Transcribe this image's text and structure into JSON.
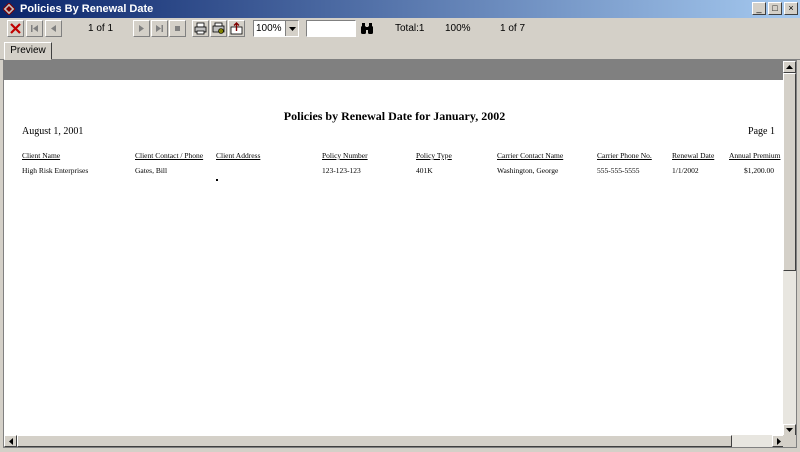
{
  "window": {
    "title": "Policies By Renewal Date",
    "minimize_glyph": "_",
    "maximize_glyph": "□",
    "close_glyph": "×"
  },
  "toolbar": {
    "page_indicator": "1 of 1",
    "zoom_value": "100%",
    "search_value": "",
    "total_label": "Total:1",
    "percent_label": "100%",
    "record_label": "1 of 7",
    "icons": [
      "close-report-icon",
      "first-page-icon",
      "prev-page-icon",
      "next-page-icon",
      "last-page-icon",
      "stop-icon",
      "print-icon",
      "print-setup-icon",
      "export-icon",
      "search-binoculars-icon"
    ]
  },
  "tabs": [
    {
      "label": "Preview"
    }
  ],
  "report": {
    "title": "Policies by Renewal Date for January, 2002",
    "date": "August 1, 2001",
    "page": "Page 1",
    "columns": [
      "Client Name",
      "Client Contact / Phone",
      "Client Address",
      "Policy Number",
      "Policy Type",
      "Carrier Contact Name",
      "Carrier Phone No.",
      "Renewal Date",
      "Annual Premium"
    ],
    "rows": [
      [
        "High Risk Enterprises",
        "Gates, Bill",
        "",
        "123-123-123",
        "401K",
        "Washington, George",
        "555-555-5555",
        "1/1/2002",
        "$1,200.00"
      ]
    ]
  },
  "colors": {
    "title_bar_start": "#0a246a",
    "title_bar_end": "#a6caf0",
    "chrome": "#d4d0c8",
    "band": "#808080",
    "close_red": "#c00000"
  }
}
